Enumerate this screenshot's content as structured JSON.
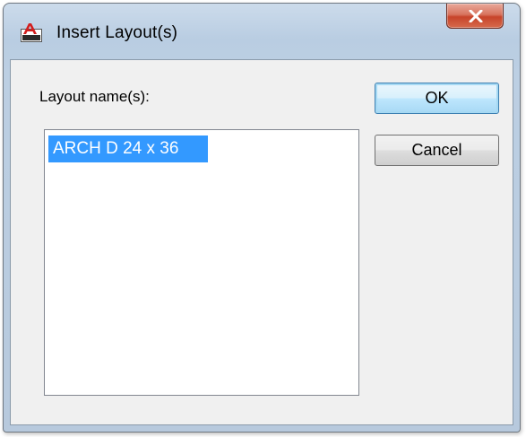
{
  "window": {
    "title": "Insert Layout(s)",
    "app_icon": "autocad-icon",
    "close_icon": "close-icon"
  },
  "dialog": {
    "list_label": "Layout name(s):",
    "layouts": [
      "ARCH D 24 x 36"
    ],
    "selected_index": 0
  },
  "buttons": {
    "ok_label": "OK",
    "cancel_label": "Cancel"
  },
  "colors": {
    "selection": "#3399ff",
    "close_button": "#c7442a",
    "app_icon_red": "#d21f1f"
  }
}
